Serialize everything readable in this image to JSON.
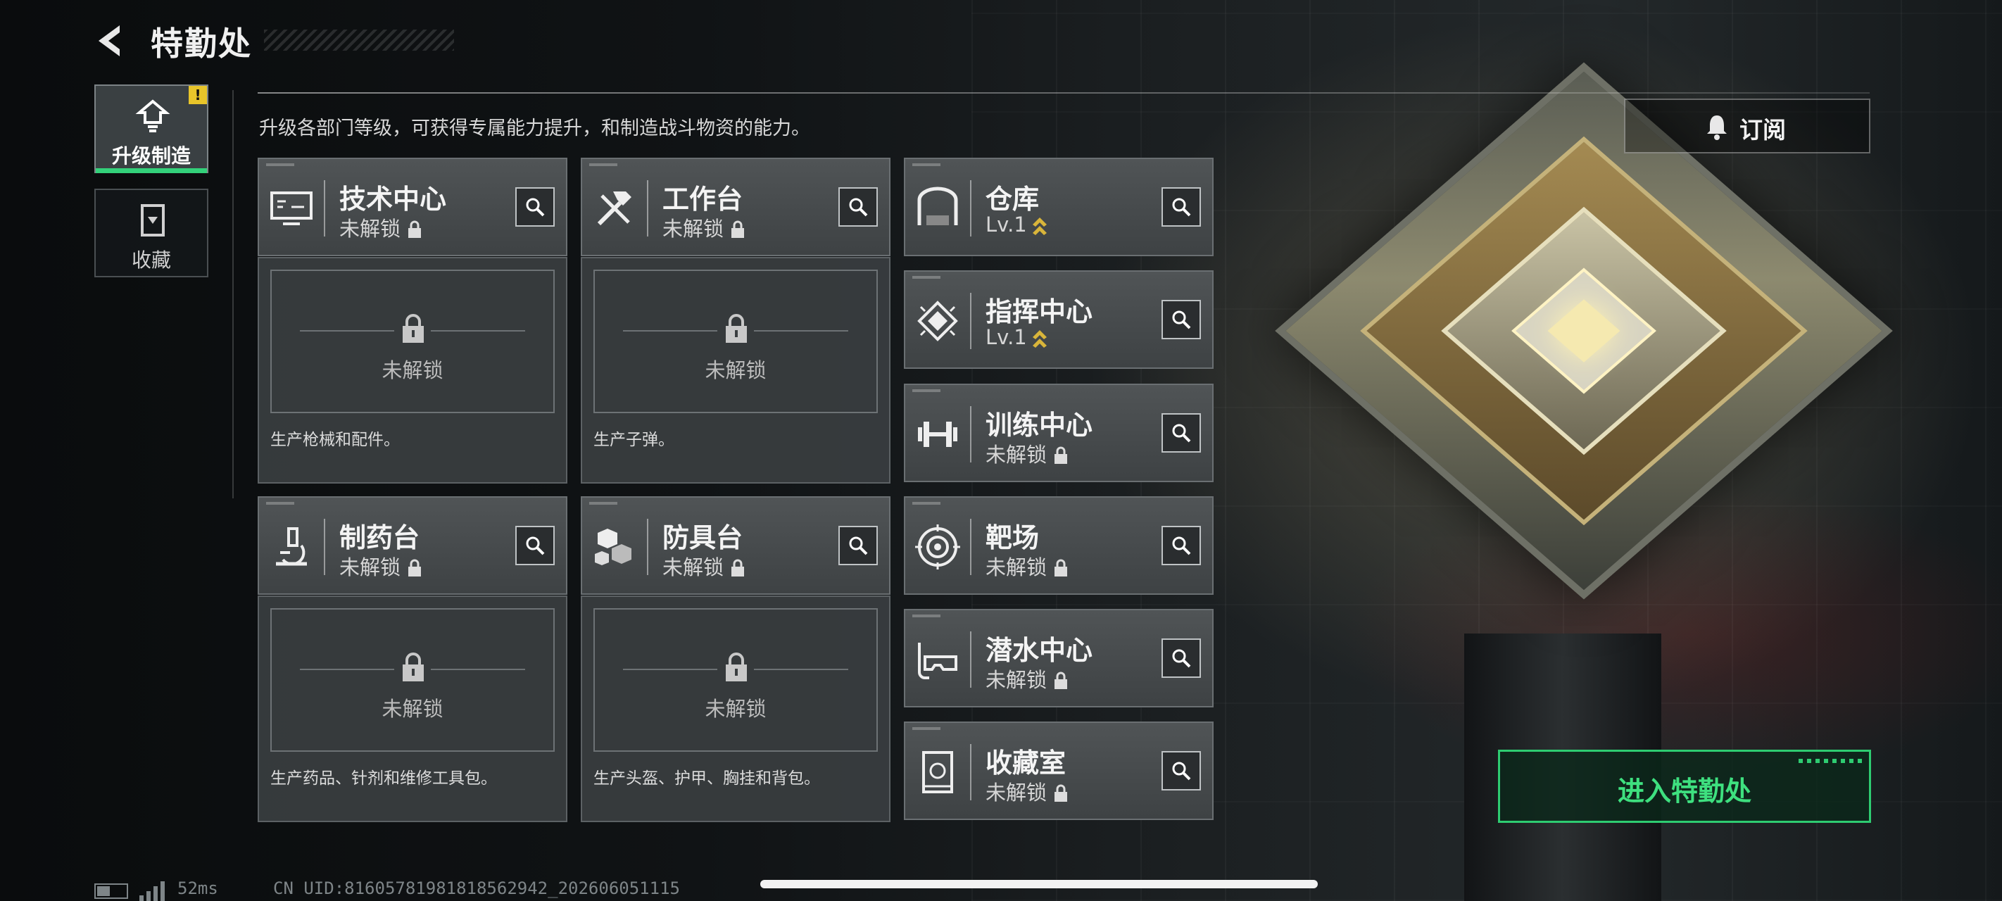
{
  "header": {
    "title": "特勤处"
  },
  "nav": {
    "tabs": [
      {
        "label": "升级制造",
        "badge": "!"
      },
      {
        "label": "收藏"
      }
    ]
  },
  "subtitle": "升级各部门等级，可获得专属能力提升，和制造战斗物资的能力。",
  "subscribe_label": "订阅",
  "enter_label": "进入特勤处",
  "big_cards": [
    {
      "name": "技术中心",
      "status": "未解锁",
      "locked_text": "未解锁",
      "desc": "生产枪械和配件。"
    },
    {
      "name": "工作台",
      "status": "未解锁",
      "locked_text": "未解锁",
      "desc": "生产子弹。"
    },
    {
      "name": "制药台",
      "status": "未解锁",
      "locked_text": "未解锁",
      "desc": "生产药品、针剂和维修工具包。"
    },
    {
      "name": "防具台",
      "status": "未解锁",
      "locked_text": "未解锁",
      "desc": "生产头盔、护甲、胸挂和背包。"
    }
  ],
  "side_cards": [
    {
      "name": "仓库",
      "status": "Lv.1",
      "icon": "garage-icon",
      "upgradeable": true
    },
    {
      "name": "指挥中心",
      "status": "Lv.1",
      "icon": "chip-icon",
      "upgradeable": true
    },
    {
      "name": "训练中心",
      "status": "未解锁",
      "icon": "dumbbell-icon",
      "upgradeable": false
    },
    {
      "name": "靶场",
      "status": "未解锁",
      "icon": "target-icon",
      "upgradeable": false
    },
    {
      "name": "潜水中心",
      "status": "未解锁",
      "icon": "diving-mask-icon",
      "upgradeable": false
    },
    {
      "name": "收藏室",
      "status": "未解锁",
      "icon": "collection-icon",
      "upgradeable": false
    }
  ],
  "footer": {
    "ping": "52ms",
    "uid": "CN UID:8160578198181856​2942_202606051115"
  },
  "colors": {
    "accent": "#33d17a",
    "warn": "#e8c52a",
    "level": "#d9b53a"
  }
}
